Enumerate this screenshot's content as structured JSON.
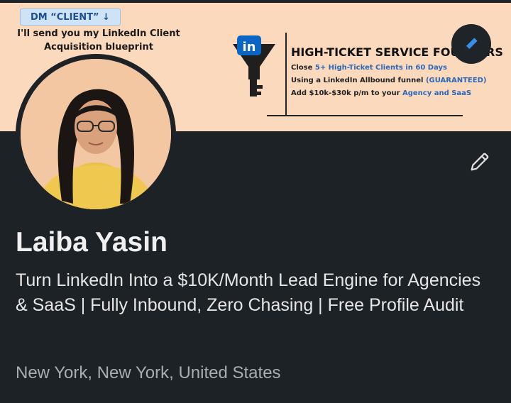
{
  "banner": {
    "dm_badge": "DM “CLIENT” ↓",
    "caption_line1": "I'll send you my LinkedIn Client",
    "caption_line2": "Acquisition blueprint",
    "logo_text": "in",
    "promo": {
      "title": "HIGH-TICKET SERVICE FOUNDERS",
      "line1_prefix": "Close ",
      "line1_highlight": "5+ High-Ticket Clients in 60 Days",
      "line2_prefix": "Using a LinkedIn Allbound funnel ",
      "line2_highlight": "(GUARANTEED)",
      "line3_prefix": "Add $10k-$30k p/m to your ",
      "line3_highlight": "Agency and SaaS"
    }
  },
  "profile": {
    "name": "Laiba Yasin",
    "headline": "Turn LinkedIn Into a $10K/Month Lead Engine for Agencies & SaaS | Fully Inbound, Zero Chasing | Free Profile Audit",
    "location": "New York, New York, United States"
  },
  "icons": {
    "edit_banner": "pencil-icon",
    "edit_intro": "pencil-icon"
  },
  "colors": {
    "background": "#1d2226",
    "banner": "#fbd9bd",
    "accent_blue": "#2b67b8",
    "edit_icon_blue": "#378fe9",
    "location_text": "#a9adb1"
  }
}
